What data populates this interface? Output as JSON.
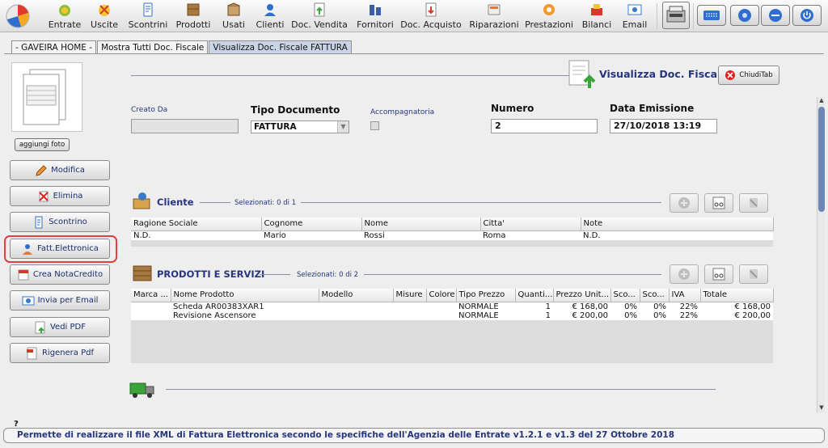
{
  "toolbar": {
    "items": [
      {
        "label": "Entrate",
        "icon": "money-bag-icon"
      },
      {
        "label": "Uscite",
        "icon": "money-out-icon"
      },
      {
        "label": "Scontrini",
        "icon": "receipt-icon"
      },
      {
        "label": "Prodotti",
        "icon": "box-icon"
      },
      {
        "label": "Usati",
        "icon": "used-box-icon"
      },
      {
        "label": "Clienti",
        "icon": "clients-icon"
      },
      {
        "label": "Doc. Vendita",
        "icon": "sale-doc-icon"
      },
      {
        "label": "Fornitori",
        "icon": "suppliers-icon"
      },
      {
        "label": "Doc. Acquisto",
        "icon": "purchase-doc-icon"
      },
      {
        "label": "Riparazioni",
        "icon": "repair-icon"
      },
      {
        "label": "Prestazioni",
        "icon": "services-icon"
      },
      {
        "label": "Bilanci",
        "icon": "balance-icon"
      },
      {
        "label": "Email",
        "icon": "email-icon"
      }
    ],
    "system_buttons": [
      "keyboard-icon",
      "settings-icon",
      "minimize-icon",
      "power-icon"
    ]
  },
  "tabs": [
    {
      "label": "- GAVEIRA HOME -",
      "active": false
    },
    {
      "label": "Mostra Tutti Doc. Fiscale",
      "active": false
    },
    {
      "label": "Visualizza Doc. Fiscale FATTURA",
      "active": true
    }
  ],
  "sidebar": {
    "add_photo": "aggiungi foto",
    "buttons": [
      {
        "label": "Modifica",
        "icon": "edit-icon"
      },
      {
        "label": "Elimina",
        "icon": "delete-icon"
      },
      {
        "label": "Scontrino",
        "icon": "receipt-icon"
      },
      {
        "label": "Fatt.Elettronica",
        "icon": "e-invoice-icon"
      },
      {
        "label": "Crea NotaCredito",
        "icon": "credit-note-icon"
      },
      {
        "label": "Invia per Email",
        "icon": "email-icon"
      },
      {
        "label": "Vedi PDF",
        "icon": "pdf-view-icon"
      },
      {
        "label": "Rigenera Pdf",
        "icon": "pdf-regenerate-icon"
      }
    ],
    "highlighted": "Fatt.Elettronica"
  },
  "header": {
    "title": "Visualizza Doc. Fiscale",
    "close_tab": "ChiudiTab"
  },
  "form": {
    "creato_da_label": "Creato Da",
    "creato_da_value": "",
    "tipo_documento_label": "Tipo Documento",
    "tipo_documento_value": "FATTURA",
    "accompagnatoria_label": "Accompagnatoria",
    "numero_label": "Numero",
    "numero_value": "2",
    "data_emissione_label": "Data Emissione",
    "data_emissione_value": "27/10/2018 13:19"
  },
  "cliente": {
    "title": "Cliente",
    "selected": "Selezionati:   0 di 1",
    "columns": [
      "Ragione Sociale",
      "Cognome",
      "Nome",
      "Citta'",
      "Note"
    ],
    "rows": [
      [
        "N.D.",
        "Mario",
        "Rossi",
        "Roma",
        "N.D."
      ]
    ]
  },
  "prodotti": {
    "title": "PRODOTTI E SERVIZI",
    "selected": "Selezionati:   0 di 2",
    "columns": [
      "Marca ...",
      "Nome Prodotto",
      "Modello",
      "Misure",
      "Colore",
      "Tipo Prezzo",
      "Quanti...",
      "Prezzo Unit...",
      "Sco...",
      "Sco...",
      "IVA",
      "Totale"
    ],
    "rows": [
      [
        "",
        "Scheda AR00383XAR1",
        "",
        "",
        "",
        "NORMALE",
        "1",
        "€ 168,00",
        "0%",
        "0%",
        "22%",
        "€ 168,00"
      ],
      [
        "",
        "Revisione Ascensore",
        "",
        "",
        "",
        "NORMALE",
        "1",
        "€ 200,00",
        "0%",
        "0%",
        "22%",
        "€ 200,00"
      ]
    ]
  },
  "status_bar": {
    "help": "?",
    "text": "Permette di realizzare il file XML di Fattura Elettronica secondo le specifiche dell'Agenzia delle Entrate v1.2.1 e v1.3 del 27 Ottobre 2018"
  }
}
